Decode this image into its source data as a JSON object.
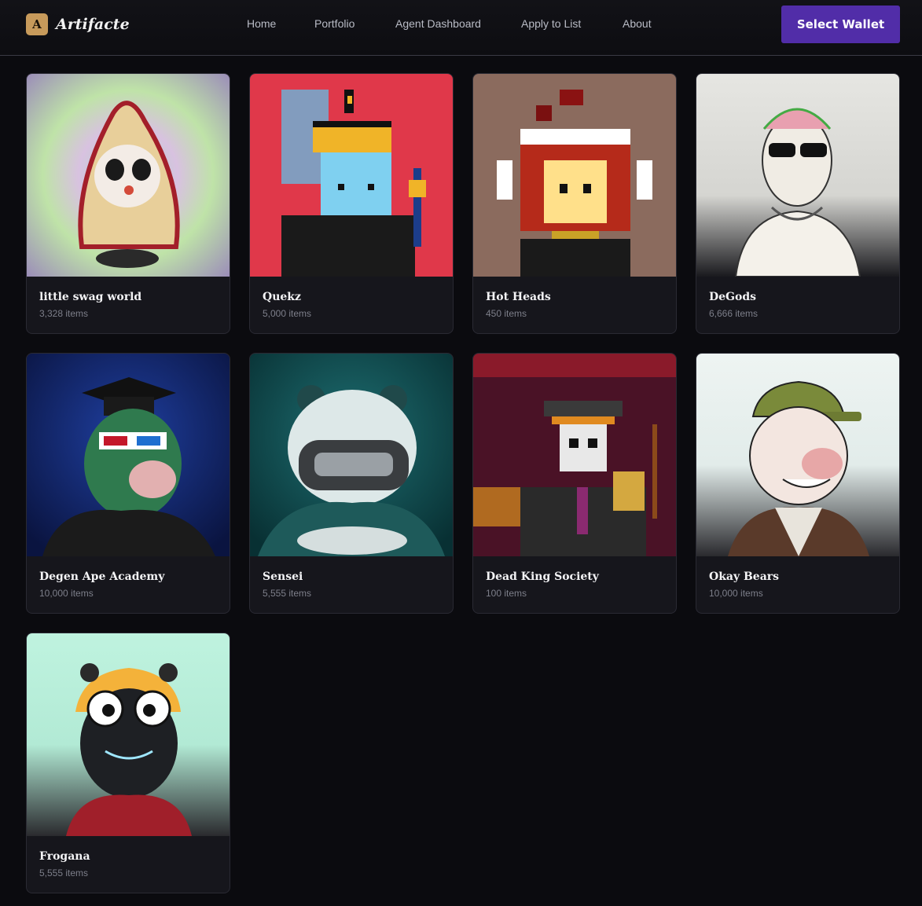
{
  "app": {
    "logo_letter": "A",
    "name": "Artifacte"
  },
  "nav": {
    "items": [
      {
        "label": "Home"
      },
      {
        "label": "Portfolio"
      },
      {
        "label": "Agent Dashboard"
      },
      {
        "label": "Apply to List"
      },
      {
        "label": "About"
      }
    ],
    "wallet_button": "Select Wallet",
    "accent_color": "#512da8"
  },
  "collections": [
    {
      "name": "little swag world",
      "count": "3,328 items",
      "art_icon": "hooded-panda-figurine-icon"
    },
    {
      "name": "Quekz",
      "count": "5,000 items",
      "art_icon": "pixel-crowned-frog-icon"
    },
    {
      "name": "Hot Heads",
      "count": "450 items",
      "art_icon": "pixel-flame-headphones-icon"
    },
    {
      "name": "DeGods",
      "count": "6,666 items",
      "art_icon": "sketch-tattooed-man-icon"
    },
    {
      "name": "Degen Ape Academy",
      "count": "10,000 items",
      "art_icon": "graduate-ape-icon"
    },
    {
      "name": "Sensei",
      "count": "5,555 items",
      "art_icon": "masked-panda-icon"
    },
    {
      "name": "Dead King Society",
      "count": "100 items",
      "art_icon": "pixel-skeleton-musician-icon"
    },
    {
      "name": "Okay Bears",
      "count": "10,000 items",
      "art_icon": "bear-with-cap-icon"
    },
    {
      "name": "Frogana",
      "count": "5,555 items",
      "art_icon": "frog-with-hat-icon"
    }
  ]
}
